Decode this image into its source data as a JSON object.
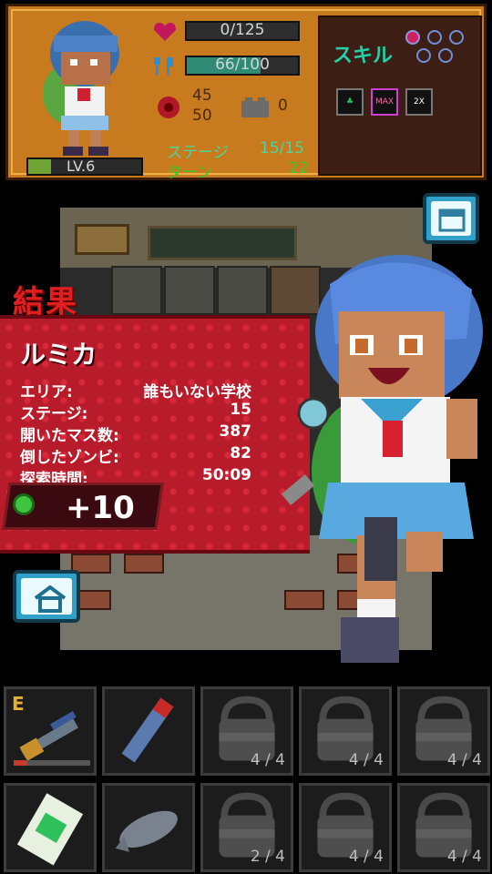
{
  "status_panel": {
    "level_label": "LV.6",
    "level_progress": 0.2,
    "health_text": "0/125",
    "health_progress": 0.0,
    "food_text": "66/100",
    "food_progress": 0.66,
    "attack_top": "45",
    "attack_bottom": "50",
    "defense": "0",
    "stage_label": "ステージ",
    "stage_value": "15/15",
    "turn_label": "ターン",
    "turn_value": "22"
  },
  "skills": {
    "title": "スキル",
    "icons": [
      "clover-skill-icon",
      "max-heart-skill-icon",
      "double-skill-icon"
    ],
    "max_label": "MAX",
    "double_label": "2X"
  },
  "result": {
    "title": "結果",
    "character_name": "ルミカ",
    "rows": [
      {
        "label": "エリア:",
        "value": "誰もいない学校"
      },
      {
        "label": "ステージ:",
        "value": "15"
      },
      {
        "label": "開いたマス数:",
        "value": "387"
      },
      {
        "label": "倒したゾンビ:",
        "value": "82"
      },
      {
        "label": "探索時間:",
        "value": "50:09"
      }
    ],
    "reward": "+10"
  },
  "inventory": [
    {
      "name": "rifle",
      "letter": "E",
      "count": "",
      "durability": 0.18
    },
    {
      "name": "flashlight",
      "letter": "",
      "count": ""
    },
    {
      "name": "bag",
      "letter": "",
      "count": "4 / 4"
    },
    {
      "name": "bag",
      "letter": "",
      "count": "4 / 4"
    },
    {
      "name": "bag",
      "letter": "",
      "count": "4 / 4"
    },
    {
      "name": "medicine-bottle",
      "letter": "",
      "count": ""
    },
    {
      "name": "fish",
      "letter": "",
      "count": ""
    },
    {
      "name": "bag",
      "letter": "",
      "count": "2 / 4"
    },
    {
      "name": "bag",
      "letter": "",
      "count": "4 / 4"
    },
    {
      "name": "bag",
      "letter": "",
      "count": "4 / 4"
    }
  ],
  "colors": {
    "panel": "#c87a1e",
    "result_red": "#b81c2a",
    "accent_teal": "#1fd2a8",
    "button_blue": "#2fa0c8"
  }
}
